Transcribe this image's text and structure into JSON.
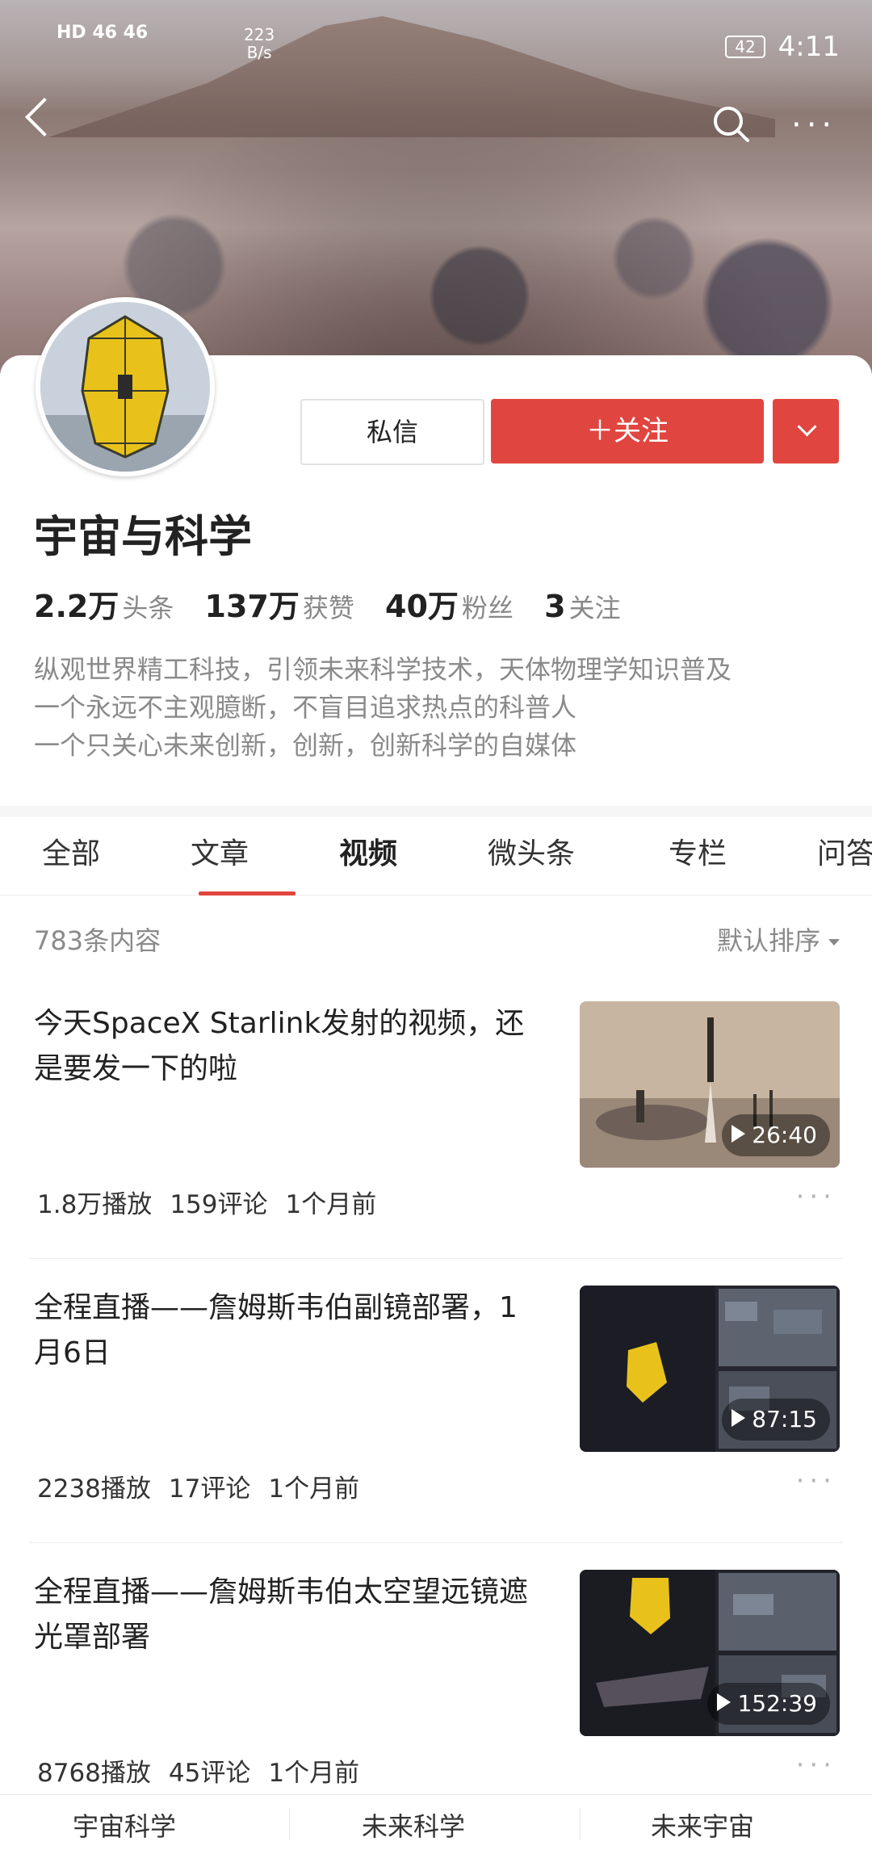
{
  "status_bar": {
    "signal": "HD 46 46",
    "network_speed_value": "223",
    "network_speed_unit": "B/s",
    "battery": "42",
    "time": "4:11"
  },
  "header": {
    "back_icon": "chevron-left-icon",
    "search_icon": "search-icon",
    "more_icon": "more-horizontal-icon"
  },
  "profile": {
    "name": "宇宙与科学",
    "message_button": "私信",
    "follow_button": "＋关注",
    "stats": [
      {
        "value": "2.2万",
        "label": "头条"
      },
      {
        "value": "137万",
        "label": "获赞"
      },
      {
        "value": "40万",
        "label": "粉丝"
      },
      {
        "value": "3",
        "label": "关注"
      }
    ],
    "bio": [
      "纵观世界精工科技，引领未来科学技术，天体物理学知识普及",
      "一个永远不主观臆断，不盲目追求热点的科普人",
      "一个只关心未来创新，创新，创新科学的自媒体"
    ]
  },
  "tabs": [
    "全部",
    "文章",
    "视频",
    "微头条",
    "专栏",
    "问答"
  ],
  "list": {
    "count": "783条内容",
    "sort": "默认排序",
    "items": [
      {
        "title": "今天SpaceX Starlink发射的视频，还是要发一下的啦",
        "duration": "26:40",
        "plays": "1.8万播放",
        "comments": "159评论",
        "time": "1个月前"
      },
      {
        "title": "全程直播——詹姆斯韦伯副镜部署，1月6日",
        "duration": "87:15",
        "plays": "2238播放",
        "comments": "17评论",
        "time": "1个月前"
      },
      {
        "title": "全程直播——詹姆斯韦伯太空望远镜遮光罩部署",
        "duration": "152:39",
        "plays": "8768播放",
        "comments": "45评论",
        "time": "1个月前"
      }
    ]
  },
  "bottom_bar": [
    "宇宙科学",
    "未来科学",
    "未来宇宙"
  ],
  "colors": {
    "accent": "#e0463f",
    "muted_text": "#8a8a8a"
  }
}
